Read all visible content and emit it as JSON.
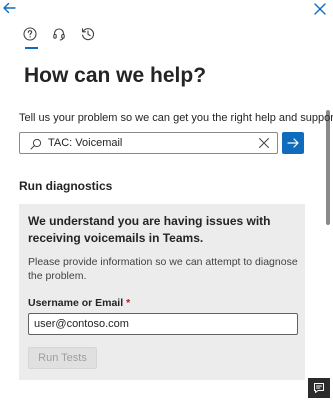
{
  "header": {
    "back_icon": "arrow-left-icon",
    "close_icon": "close-icon",
    "accent_color": "#0f6cbd",
    "tabs": [
      {
        "icon": "question-circle-icon",
        "selected": true
      },
      {
        "icon": "headset-icon",
        "selected": false
      },
      {
        "icon": "history-icon",
        "selected": false
      }
    ]
  },
  "main": {
    "title": "How can we help?",
    "description": "Tell us your problem so we can get you the right help and support.",
    "search": {
      "value": "TAC: Voicemail",
      "icon": "search-icon",
      "clear_icon": "dismiss-icon",
      "submit_icon": "arrow-right-icon"
    },
    "diagnostics": {
      "section_title": "Run diagnostics",
      "heading": "We understand you are having issues with receiving voicemails in Teams.",
      "body": "Please provide information so we can attempt to diagnose the problem.",
      "field_label": "Username or Email",
      "required_marker": "*",
      "field_value": "user@contoso.com",
      "button_label": "Run Tests"
    }
  },
  "footer": {
    "feedback_icon": "chat-feedback-icon"
  }
}
